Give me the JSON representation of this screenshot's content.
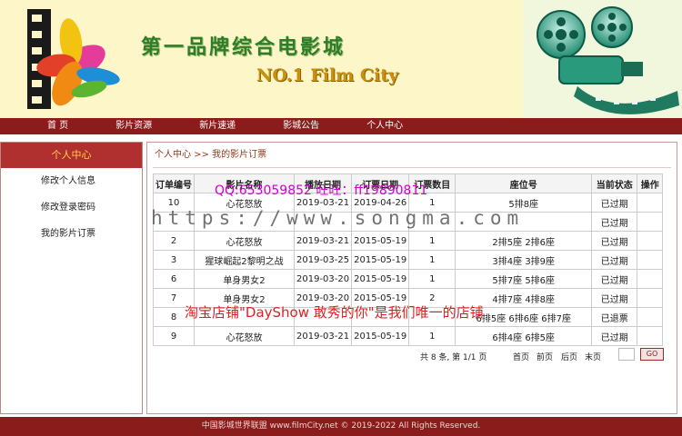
{
  "header": {
    "brand_cn": "第一品牌综合电影城",
    "brand_en": "NO.1 Film City"
  },
  "nav": [
    "首 页",
    "影片资源",
    "新片速递",
    "影城公告",
    "个人中心"
  ],
  "sidebar": {
    "head": "个人中心",
    "items": [
      "修改个人信息",
      "修改登录密码",
      "我的影片订票"
    ]
  },
  "breadcrumb": "个人中心 >> 我的影片订票",
  "table": {
    "columns": [
      "订单编号",
      "影片名称",
      "播放日期",
      "订票日期",
      "订票数目",
      "座位号",
      "当前状态",
      "操作"
    ],
    "rows": [
      [
        "10",
        "心花怒放",
        "2019-03-21",
        "2019-04-26",
        "1",
        "5排8座",
        "已过期",
        ""
      ],
      [
        "",
        "",
        "",
        "",
        "",
        "",
        "已过期",
        ""
      ],
      [
        "2",
        "心花怒放",
        "2019-03-21",
        "2015-05-19",
        "1",
        "2排5座 2排6座",
        "已过期",
        ""
      ],
      [
        "3",
        "猩球崛起2黎明之战",
        "2019-03-25",
        "2015-05-19",
        "1",
        "3排4座 3排9座",
        "已过期",
        ""
      ],
      [
        "6",
        "单身男女2",
        "2019-03-20",
        "2015-05-19",
        "1",
        "5排7座 5排6座",
        "已过期",
        ""
      ],
      [
        "7",
        "单身男女2",
        "2019-03-20",
        "2015-05-19",
        "2",
        "4排7座 4排8座",
        "已过期",
        ""
      ],
      [
        "8",
        "",
        "",
        "",
        "",
        "6排5座 6排6座 6排7座",
        "已退票",
        ""
      ],
      [
        "9",
        "心花怒放",
        "2019-03-21",
        "2015-05-19",
        "1",
        "6排4座 6排5座",
        "已过期",
        ""
      ]
    ]
  },
  "pager": {
    "count": "共 8 条, 第 1/1 页",
    "first": "首页",
    "prev": "前页",
    "next": "后页",
    "last": "末页",
    "go": "GO"
  },
  "footer": "中国影城世界联盟 www.filmCity.net © 2019-2022 All Rights Reserved.",
  "watermarks": {
    "qq": "QQ:653059852      旺旺：ff19890811",
    "url": "https://www.songma.com",
    "shop": "淘宝店铺\"DayShow 敢秀的你\"是我们唯一的店铺"
  },
  "colors": {
    "nav": "#8b1c1c",
    "header_bg": "#fdf6c8",
    "sidebar_head": "#b02f2f",
    "sidebar_head_text": "#ffd24a"
  }
}
